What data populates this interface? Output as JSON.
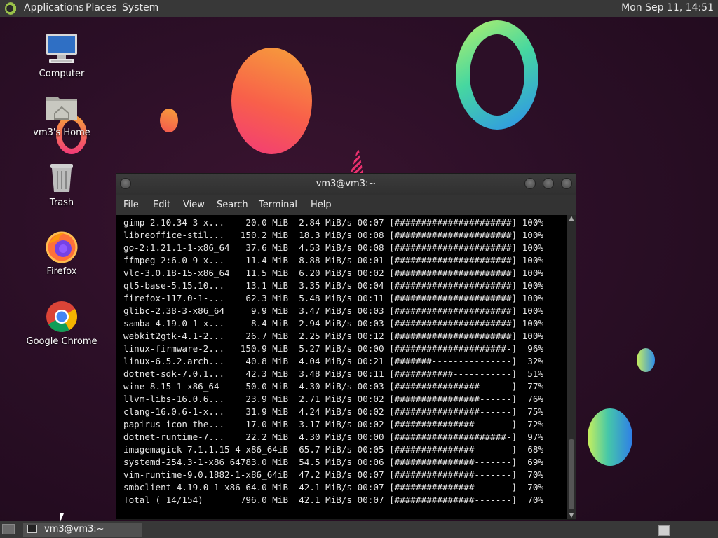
{
  "top_panel": {
    "menus": [
      "Applications",
      "Places",
      "System"
    ],
    "clock": "Mon Sep 11, 14:51"
  },
  "desktop_icons": [
    {
      "label": "Computer",
      "icon": "computer-icon"
    },
    {
      "label": "vm3's Home",
      "icon": "home-folder-icon"
    },
    {
      "label": "Trash",
      "icon": "trash-icon"
    },
    {
      "label": "Firefox",
      "icon": "firefox-icon"
    },
    {
      "label": "Google Chrome",
      "icon": "chrome-icon"
    }
  ],
  "terminal": {
    "title": "vm3@vm3:~",
    "menu": [
      "File",
      "Edit",
      "View",
      "Search",
      "Terminal",
      "Help"
    ],
    "lines": [
      "gimp-2.10.34-3-x...    20.0 MiB  2.84 MiB/s 00:07 [######################] 100%",
      "libreoffice-stil...   150.2 MiB  18.3 MiB/s 00:08 [######################] 100%",
      "go-2:1.21.1-1-x86_64   37.6 MiB  4.53 MiB/s 00:08 [######################] 100%",
      "ffmpeg-2:6.0-9-x...    11.4 MiB  8.88 MiB/s 00:01 [######################] 100%",
      "vlc-3.0.18-15-x86_64   11.5 MiB  6.20 MiB/s 00:02 [######################] 100%",
      "qt5-base-5.15.10...    13.1 MiB  3.35 MiB/s 00:04 [######################] 100%",
      "firefox-117.0-1-...    62.3 MiB  5.48 MiB/s 00:11 [######################] 100%",
      "glibc-2.38-3-x86_64     9.9 MiB  3.47 MiB/s 00:03 [######################] 100%",
      "samba-4.19.0-1-x...     8.4 MiB  2.94 MiB/s 00:03 [######################] 100%",
      "webkit2gtk-4.1-2...    26.7 MiB  2.25 MiB/s 00:12 [######################] 100%",
      "linux-firmware-2...   150.9 MiB  5.27 MiB/s 00:00 [#####################-]  96%",
      "linux-6.5.2.arch...    40.8 MiB  4.04 MiB/s 00:21 [#######---------------]  32%",
      "dotnet-sdk-7.0.1...    42.3 MiB  3.48 MiB/s 00:11 [###########-----------]  51%",
      "wine-8.15-1-x86_64     50.0 MiB  4.30 MiB/s 00:03 [################------]  77%",
      "llvm-libs-16.0.6...    23.9 MiB  2.71 MiB/s 00:02 [################------]  76%",
      "clang-16.0.6-1-x...    31.9 MiB  4.24 MiB/s 00:02 [################------]  75%",
      "papirus-icon-the...    17.0 MiB  3.17 MiB/s 00:02 [###############-------]  72%",
      "dotnet-runtime-7...    22.2 MiB  4.30 MiB/s 00:00 [#####################-]  97%",
      "imagemagick-7.1.1.15-4-x86_64iB  65.7 MiB/s 00:05 [###############-------]  68%",
      "systemd-254.3-1-x86_64783.0 MiB  54.5 MiB/s 00:06 [###############-------]  69%",
      "vim-runtime-9.0.1882-1-x86_64iB  47.2 MiB/s 00:07 [###############-------]  70%",
      "smbclient-4.19.0-1-x86_64.0 MiB  42.1 MiB/s 00:07 [###############-------]  70%",
      "Total ( 14/154)       796.0 MiB  42.1 MiB/s 00:07 [###############-------]  70%"
    ]
  },
  "taskbar": {
    "task_label": "vm3@vm3:~"
  }
}
